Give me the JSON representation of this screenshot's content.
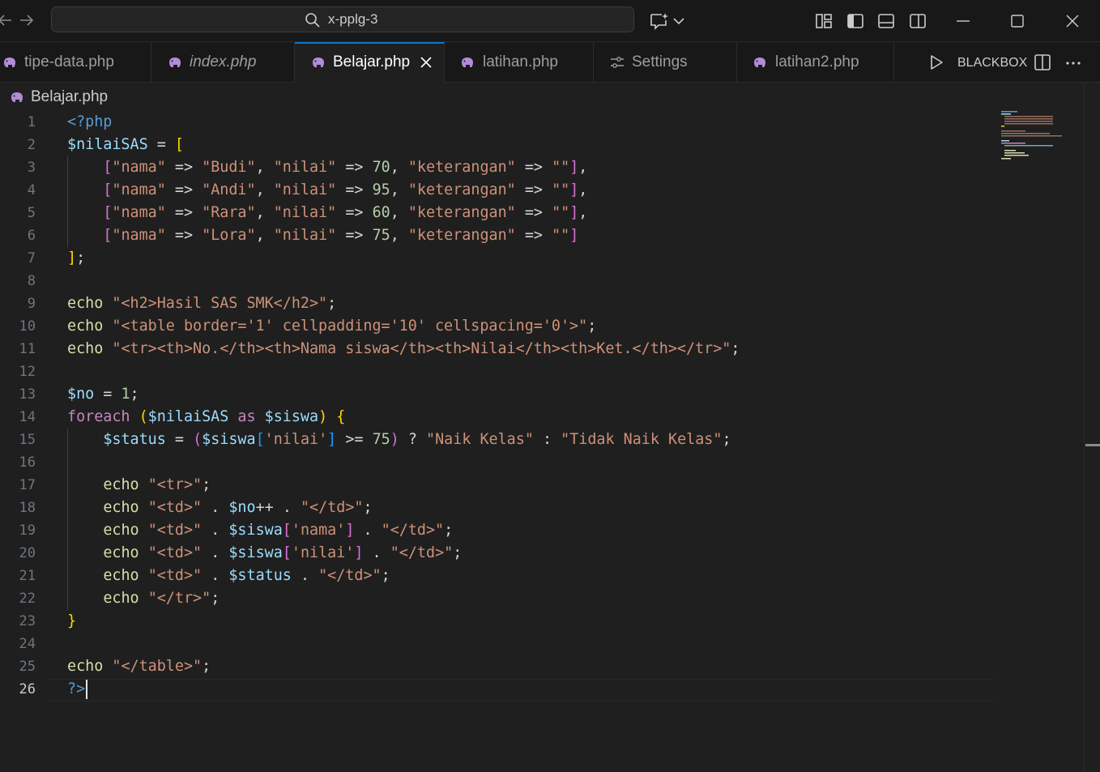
{
  "titlebar": {
    "command_center_text": "x-pplg-3",
    "icons": [
      "back-arrow-icon",
      "forward-arrow-icon",
      "search-icon",
      "copilot-chat-icon",
      "chevron-down-icon",
      "customize-layout-icon",
      "toggle-primary-sidebar-icon",
      "toggle-panel-icon",
      "toggle-secondary-sidebar-icon",
      "minimize-icon",
      "maximize-icon",
      "close-window-icon"
    ]
  },
  "tabs": [
    {
      "label": "tipe-data.php",
      "icon": "php-elephant-icon",
      "active": false,
      "italic": false
    },
    {
      "label": "index.php",
      "icon": "php-elephant-icon",
      "active": false,
      "italic": true
    },
    {
      "label": "Belajar.php",
      "icon": "php-elephant-icon",
      "active": true,
      "italic": false
    },
    {
      "label": "latihan.php",
      "icon": "php-elephant-icon",
      "active": false,
      "italic": false
    },
    {
      "label": "Settings",
      "icon": "settings-sliders-icon",
      "active": false,
      "italic": false
    },
    {
      "label": "latihan2.php",
      "icon": "php-elephant-icon",
      "active": false,
      "italic": false
    }
  ],
  "tab_actions": {
    "run_label": "BLACKBOX",
    "icons": [
      "run-icon",
      "split-editor-icon",
      "more-actions-icon"
    ]
  },
  "breadcrumb": {
    "file": "Belajar.php"
  },
  "editor": {
    "current_line": 26,
    "lines": [
      "<?php",
      "$nilaiSAS = [",
      "    [\"nama\" => \"Budi\", \"nilai\" => 70, \"keterangan\" => \"\"],",
      "    [\"nama\" => \"Andi\", \"nilai\" => 95, \"keterangan\" => \"\"],",
      "    [\"nama\" => \"Rara\", \"nilai\" => 60, \"keterangan\" => \"\"],",
      "    [\"nama\" => \"Lora\", \"nilai\" => 75, \"keterangan\" => \"\"]",
      "];",
      "",
      "echo \"<h2>Hasil SAS SMK</h2>\";",
      "echo \"<table border='1' cellpadding='10' cellspacing='0'>\";",
      "echo \"<tr><th>No.</th><th>Nama siswa</th><th>Nilai</th><th>Ket.</th></tr>\";",
      "",
      "$no = 1;",
      "foreach ($nilaiSAS as $siswa) {",
      "    $status = ($siswa['nilai'] >= 75) ? \"Naik Kelas\" : \"Tidak Naik Kelas\";",
      "",
      "    echo \"<tr>\";",
      "    echo \"<td>\" . $no++ . \"</td>\";",
      "    echo \"<td>\" . $siswa['nama'] . \"</td>\";",
      "    echo \"<td>\" . $siswa['nilai'] . \"</td>\";",
      "    echo \"<td>\" . $status . \"</td>\";",
      "    echo \"</tr>\";",
      "}",
      "",
      "echo \"</table>\";",
      "?>"
    ]
  },
  "colors": {
    "background": "#1f1f1f",
    "titlebar": "#181818",
    "accent": "#0078d4",
    "php_icon": "#b18bd6",
    "tag": "#569cd6",
    "variable": "#9cdcfe",
    "string": "#ce9178",
    "number": "#b5cea8",
    "keyword": "#c586c0",
    "function": "#dcdcaa",
    "bracket_1": "#ffd700",
    "bracket_2": "#da70d6",
    "bracket_3": "#179fff"
  }
}
